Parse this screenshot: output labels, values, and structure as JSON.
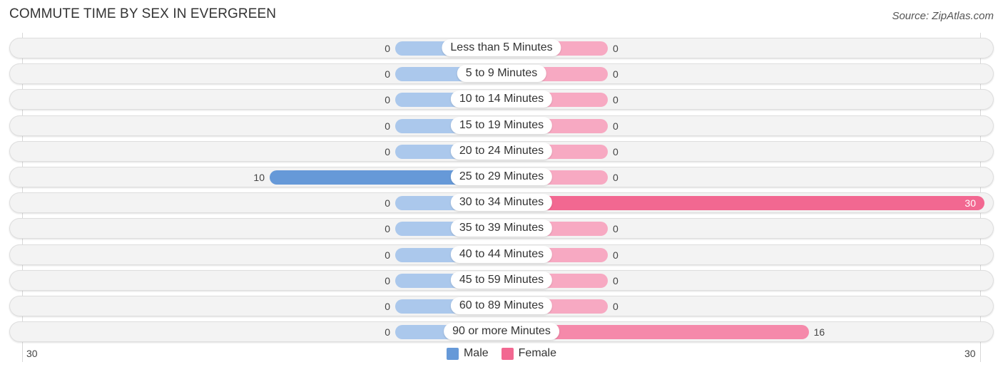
{
  "title": "COMMUTE TIME BY SEX IN EVERGREEN",
  "source": "Source: ZipAtlas.com",
  "colors": {
    "male": "#abc8ec",
    "male_strong": "#6699d8",
    "female": "#f7a9c2",
    "female_strong": "#f26891",
    "legend_male": "#6699d8",
    "legend_female": "#f26891"
  },
  "legend": {
    "male": "Male",
    "female": "Female"
  },
  "axis": {
    "left_tick": "30",
    "right_tick": "30"
  },
  "chart_data": {
    "type": "bar",
    "orientation": "horizontal-diverging",
    "title": "COMMUTE TIME BY SEX IN EVERGREEN",
    "categories": [
      "Less than 5 Minutes",
      "5 to 9 Minutes",
      "10 to 14 Minutes",
      "15 to 19 Minutes",
      "20 to 24 Minutes",
      "25 to 29 Minutes",
      "30 to 34 Minutes",
      "35 to 39 Minutes",
      "40 to 44 Minutes",
      "45 to 59 Minutes",
      "60 to 89 Minutes",
      "90 or more Minutes"
    ],
    "series": [
      {
        "name": "Male",
        "values": [
          0,
          0,
          0,
          0,
          0,
          10,
          0,
          0,
          0,
          0,
          0,
          0
        ]
      },
      {
        "name": "Female",
        "values": [
          0,
          0,
          0,
          0,
          0,
          0,
          30,
          0,
          0,
          0,
          0,
          16
        ]
      }
    ],
    "xlim": [
      30,
      30
    ],
    "x_tick_labels": [
      "30",
      "30"
    ],
    "legend_position": "bottom-center",
    "grid": false
  }
}
